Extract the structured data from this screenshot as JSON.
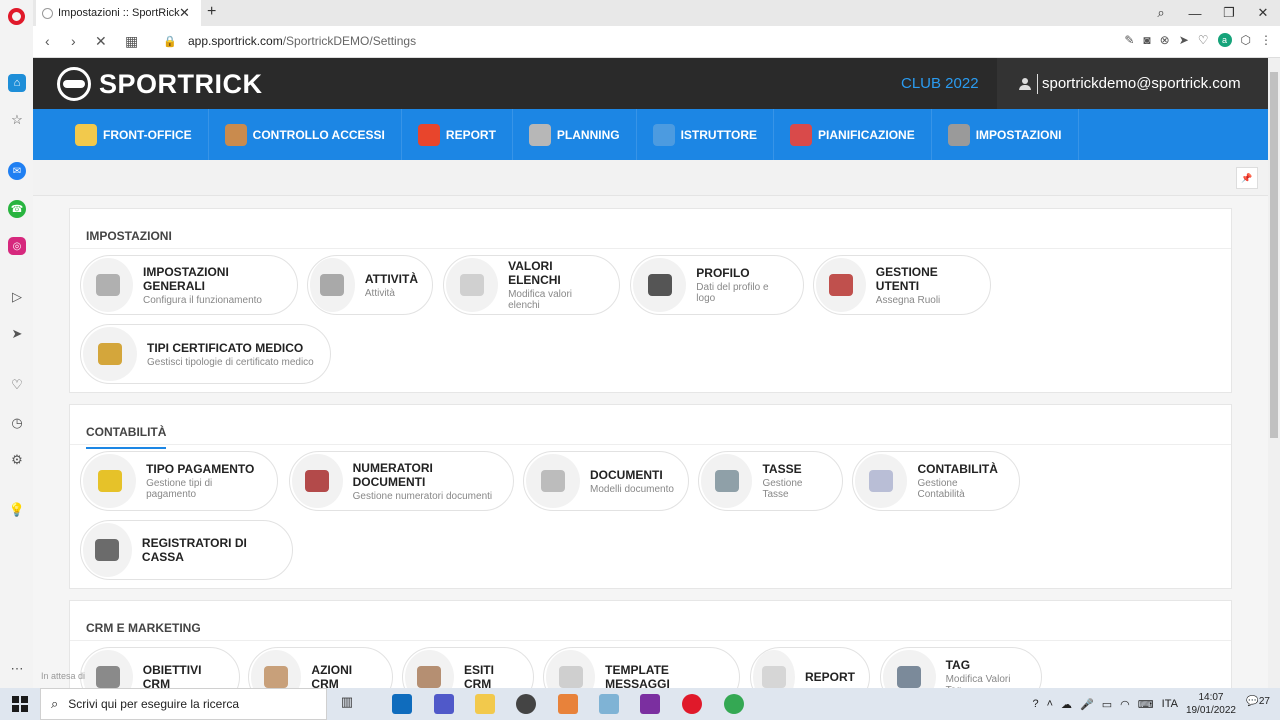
{
  "browser": {
    "tab_title": "Impostazioni :: SportRick",
    "url_host": "app.sportrick.com",
    "url_path": "/SportrickDEMO/Settings"
  },
  "header": {
    "logo_text": "SPORTRICK",
    "club": "CLUB 2022",
    "user_email": "sportrickdemo@sportrick.com"
  },
  "nav": [
    {
      "label": "FRONT-OFFICE",
      "icon": "user-icon",
      "color": "#f2c94c"
    },
    {
      "label": "CONTROLLO ACCESSI",
      "icon": "turnstile-icon",
      "color": "#c98b4e"
    },
    {
      "label": "REPORT",
      "icon": "pie-chart-icon",
      "color": "#e8452c"
    },
    {
      "label": "PLANNING",
      "icon": "calendar-icon",
      "color": "#b7b7b7"
    },
    {
      "label": "ISTRUTTORE",
      "icon": "group-icon",
      "color": "#4c9be0"
    },
    {
      "label": "PIANIFICAZIONE",
      "icon": "calendar-red-icon",
      "color": "#d94a4a"
    },
    {
      "label": "IMPOSTAZIONI",
      "icon": "gear-icon",
      "color": "#9a9a9a",
      "active": true
    }
  ],
  "sections": [
    {
      "title": "IMPOSTAZIONI",
      "tiles": [
        {
          "title": "IMPOSTAZIONI GENERALI",
          "sub": "Configura il funzionamento",
          "icon": "wrench-icon",
          "color": "#b0b0b0"
        },
        {
          "title": "ATTIVITÀ",
          "sub": "Attività",
          "icon": "activity-icon",
          "color": "#a9a9a9"
        },
        {
          "title": "VALORI ELENCHI",
          "sub": "Modifica valori elenchi",
          "icon": "list-icon",
          "color": "#d0d0d0"
        },
        {
          "title": "PROFILO",
          "sub": "Dati del profilo e logo",
          "icon": "profile-icon",
          "color": "#555555"
        },
        {
          "title": "GESTIONE UTENTI",
          "sub": "Assegna Ruoli",
          "icon": "users-icon",
          "color": "#c0504d"
        },
        {
          "title": "TIPI CERTIFICATO MEDICO",
          "sub": "Gestisci tipologie di certificato medico",
          "icon": "certificate-icon",
          "color": "#d4a63b"
        }
      ]
    },
    {
      "title": "CONTABILITÀ",
      "tiles": [
        {
          "title": "TIPO PAGAMENTO",
          "sub": "Gestione tipi di pagamento",
          "icon": "coin-icon",
          "color": "#e6c229"
        },
        {
          "title": "NUMERATORI DOCUMENTI",
          "sub": "Gestione numeratori documenti",
          "icon": "counter-icon",
          "color": "#b34a4a"
        },
        {
          "title": "DOCUMENTI",
          "sub": "Modelli documento",
          "icon": "document-icon",
          "color": "#bcbcbc"
        },
        {
          "title": "TASSE",
          "sub": "Gestione Tasse",
          "icon": "tax-icon",
          "color": "#8fa0a8"
        },
        {
          "title": "CONTABILITÀ",
          "sub": "Gestione Contabilità",
          "icon": "ledger-icon",
          "color": "#b9bed6"
        },
        {
          "title": "REGISTRATORI DI CASSA",
          "sub": "",
          "icon": "cash-register-icon",
          "color": "#6b6b6b"
        }
      ]
    },
    {
      "title": "CRM E MARKETING",
      "tiles": [
        {
          "title": "OBIETTIVI CRM",
          "sub": "",
          "icon": "target-icon",
          "color": "#8a8a8a"
        },
        {
          "title": "AZIONI CRM",
          "sub": "",
          "icon": "handshake-icon",
          "color": "#c8a07a"
        },
        {
          "title": "ESITI CRM",
          "sub": "",
          "icon": "handshake2-icon",
          "color": "#b58f72"
        },
        {
          "title": "TEMPLATE MESSAGGI",
          "sub": "",
          "icon": "mail-icon",
          "color": "#cfcfcf"
        },
        {
          "title": "REPORT",
          "sub": "",
          "icon": "report-icon",
          "color": "#d6d6d6"
        },
        {
          "title": "TAG",
          "sub": "Modifica Valori Tag",
          "icon": "tag-icon",
          "color": "#7b8a9a"
        }
      ]
    }
  ],
  "status_text": "In attesa di ",
  "taskbar": {
    "search_placeholder": "Scrivi qui per eseguire la ricerca",
    "lang": "ITA",
    "time": "14:07",
    "date": "19/01/2022",
    "notifications": "27"
  }
}
